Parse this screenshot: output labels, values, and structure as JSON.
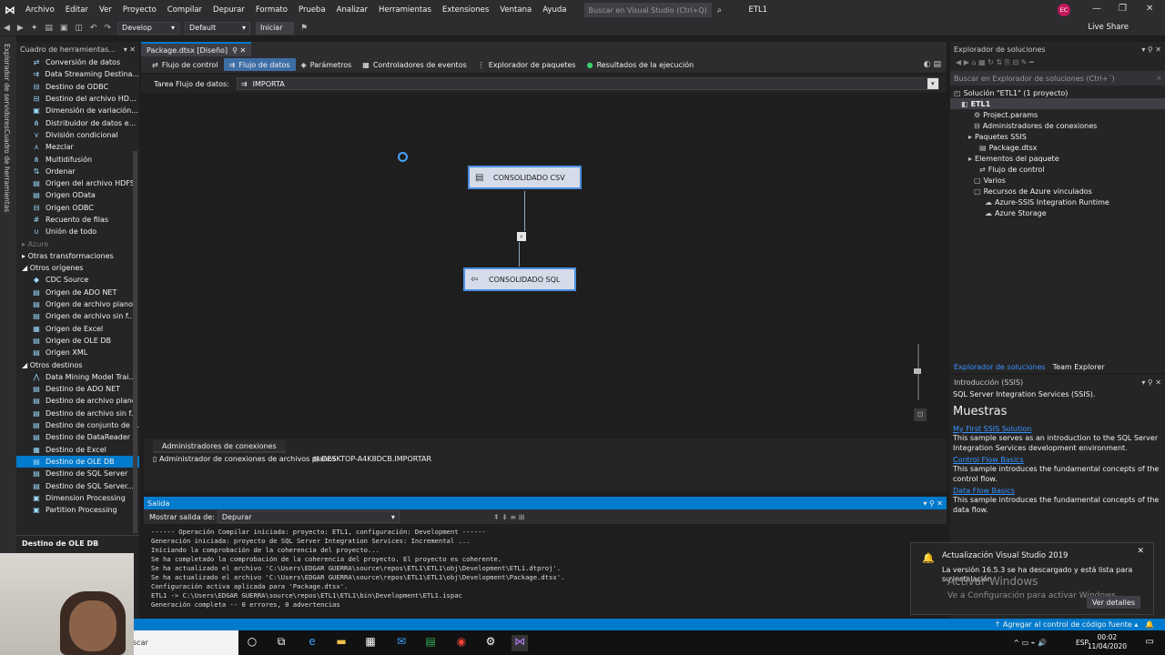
{
  "menu": {
    "items": [
      "Archivo",
      "Editar",
      "Ver",
      "Proyecto",
      "Compilar",
      "Depurar",
      "Formato",
      "Prueba",
      "Analizar",
      "Herramientas",
      "Extensiones",
      "Ventana",
      "Ayuda"
    ],
    "search_placeholder": "Buscar en Visual Studio (Ctrl+Q)",
    "project_title": "ETL1",
    "avatar": "EC"
  },
  "toolbar": {
    "config": "Develop",
    "platform": "Default",
    "start": "Iniciar",
    "live_share": "Live Share"
  },
  "side_tabs": [
    "Explorador de servidores",
    "Cuadro de herramientas"
  ],
  "toolbox": {
    "title": "Cuadro de herramientas...",
    "items_top": [
      "Conversión de datos",
      "Data Streaming Destina...",
      "Destino de ODBC",
      "Destino del archivo HD...",
      "Dimensión de variación...",
      "Distribuidor de datos e...",
      "División condicional",
      "Mezclar",
      "Multidifusión",
      "Ordenar",
      "Origen del archivo HDFS",
      "Origen OData",
      "Origen ODBC",
      "Recuento de filas",
      "Unión de todo"
    ],
    "group_azure": "Azure",
    "group_otras_transf": "Otras transformaciones",
    "group_otros_origenes": "Otros orígenes",
    "items_origenes": [
      "CDC Source",
      "Origen de ADO NET",
      "Origen de archivo plano",
      "Origen de archivo sin f...",
      "Origen de Excel",
      "Origen de OLE DB",
      "Origen XML"
    ],
    "group_otros_destinos": "Otros destinos",
    "items_destinos": [
      "Data Mining Model Trai...",
      "Destino de ADO NET",
      "Destino de archivo plano",
      "Destino de archivo sin f...",
      "Destino de conjunto de ...",
      "Destino de DataReader",
      "Destino de Excel",
      "Destino de OLE DB",
      "Destino de SQL Server",
      "Destino de SQL Server...",
      "Dimension Processing",
      "Partition Processing"
    ],
    "selected_item": "Destino de OLE DB",
    "detail_title": "Destino de OLE DB"
  },
  "document": {
    "tab": "Package.dtsx [Diseño]",
    "designer_tabs": [
      "Flujo de control",
      "Flujo de datos",
      "Parámetros",
      "Controladores de eventos",
      "Explorador de paquetes",
      "Resultados de la ejecución"
    ],
    "active_tab": "Flujo de datos",
    "task_label": "Tarea Flujo de datos:",
    "task_value": "IMPORTA"
  },
  "components": {
    "source": "CONSOLIDADO CSV",
    "destination": "CONSOLIDADO SQL"
  },
  "connection_managers": {
    "tab": "Administradores de conexiones",
    "items": [
      "Administrador de conexiones de archivos planos",
      "DESKTOP-A4K8DCB.IMPORTAR"
    ]
  },
  "output": {
    "title": "Salida",
    "source_label": "Mostrar salida de:",
    "source_value": "Depurar",
    "lines": [
      "------ Operación Compilar iniciada: proyecto: ETL1, configuración: Development ------",
      "Generación iniciada: proyecto de SQL Server Integration Services: Incremental ...",
      "Iniciando la comprobación de la coherencia del proyecto...",
      "Se ha completado la comprobación de la coherencia del proyecto. El proyecto es coherente.",
      "Se ha actualizado el archivo 'C:\\Users\\EDGAR GUERRA\\source\\repos\\ETL1\\ETL1\\obj\\Development\\ETL1.dtproj'.",
      "Se ha actualizado el archivo 'C:\\Users\\EDGAR GUERRA\\source\\repos\\ETL1\\ETL1\\obj\\Development\\Package.dtsx'.",
      "Configuración activa aplicada para 'Package.dtsx'.",
      "ETL1 -> C:\\Users\\EDGAR GUERRA\\source\\repos\\ETL1\\ETL1\\bin\\Development\\ETL1.ispac",
      "Generación completa -- 0 errores, 0 advertencias"
    ]
  },
  "solution_explorer": {
    "title": "Explorador de soluciones",
    "search_placeholder": "Buscar en Explorador de soluciones (Ctrl+´)",
    "tree": [
      "Solución \"ETL1\" (1 proyecto)",
      "ETL1",
      "Project.params",
      "Administradores de conexiones",
      "Paquetes SSIS",
      "Package.dtsx",
      "Elementos del paquete",
      "Flujo de control",
      "Varios",
      "Recursos de Azure vinculados",
      "Azure-SSIS Integration Runtime",
      "Azure Storage"
    ],
    "footer_tabs": [
      "Explorador de soluciones",
      "Team Explorer"
    ]
  },
  "intro": {
    "title": "Introducción (SSIS)",
    "subtitle": "SQL Server Integration Services (SSIS).",
    "heading": "Muestras",
    "samples": [
      {
        "link": "My First SSIS Solution",
        "text": "This sample serves as an introduction to the SQL Server Integration Services development environment."
      },
      {
        "link": "Control Flow Basics",
        "text": "This sample introduces the fundamental concepts of the control flow."
      },
      {
        "link": "Data Flow Basics",
        "text": "This sample introduces the fundamental concepts of the data flow."
      }
    ]
  },
  "notification": {
    "title": "Actualización Visual Studio 2019",
    "message": "La versión 16.5.3 se ha descargado y está lista para su instalación.",
    "watermark1": "Activar Windows",
    "watermark2": "Ve a Configuración para activar Windows.",
    "button": "Ver detalles"
  },
  "statusbar": {
    "source_control": "Agregar al control de código fuente"
  },
  "taskbar": {
    "search": "scar",
    "lang": "ESP",
    "time": "00:02",
    "date": "11/04/2020"
  }
}
